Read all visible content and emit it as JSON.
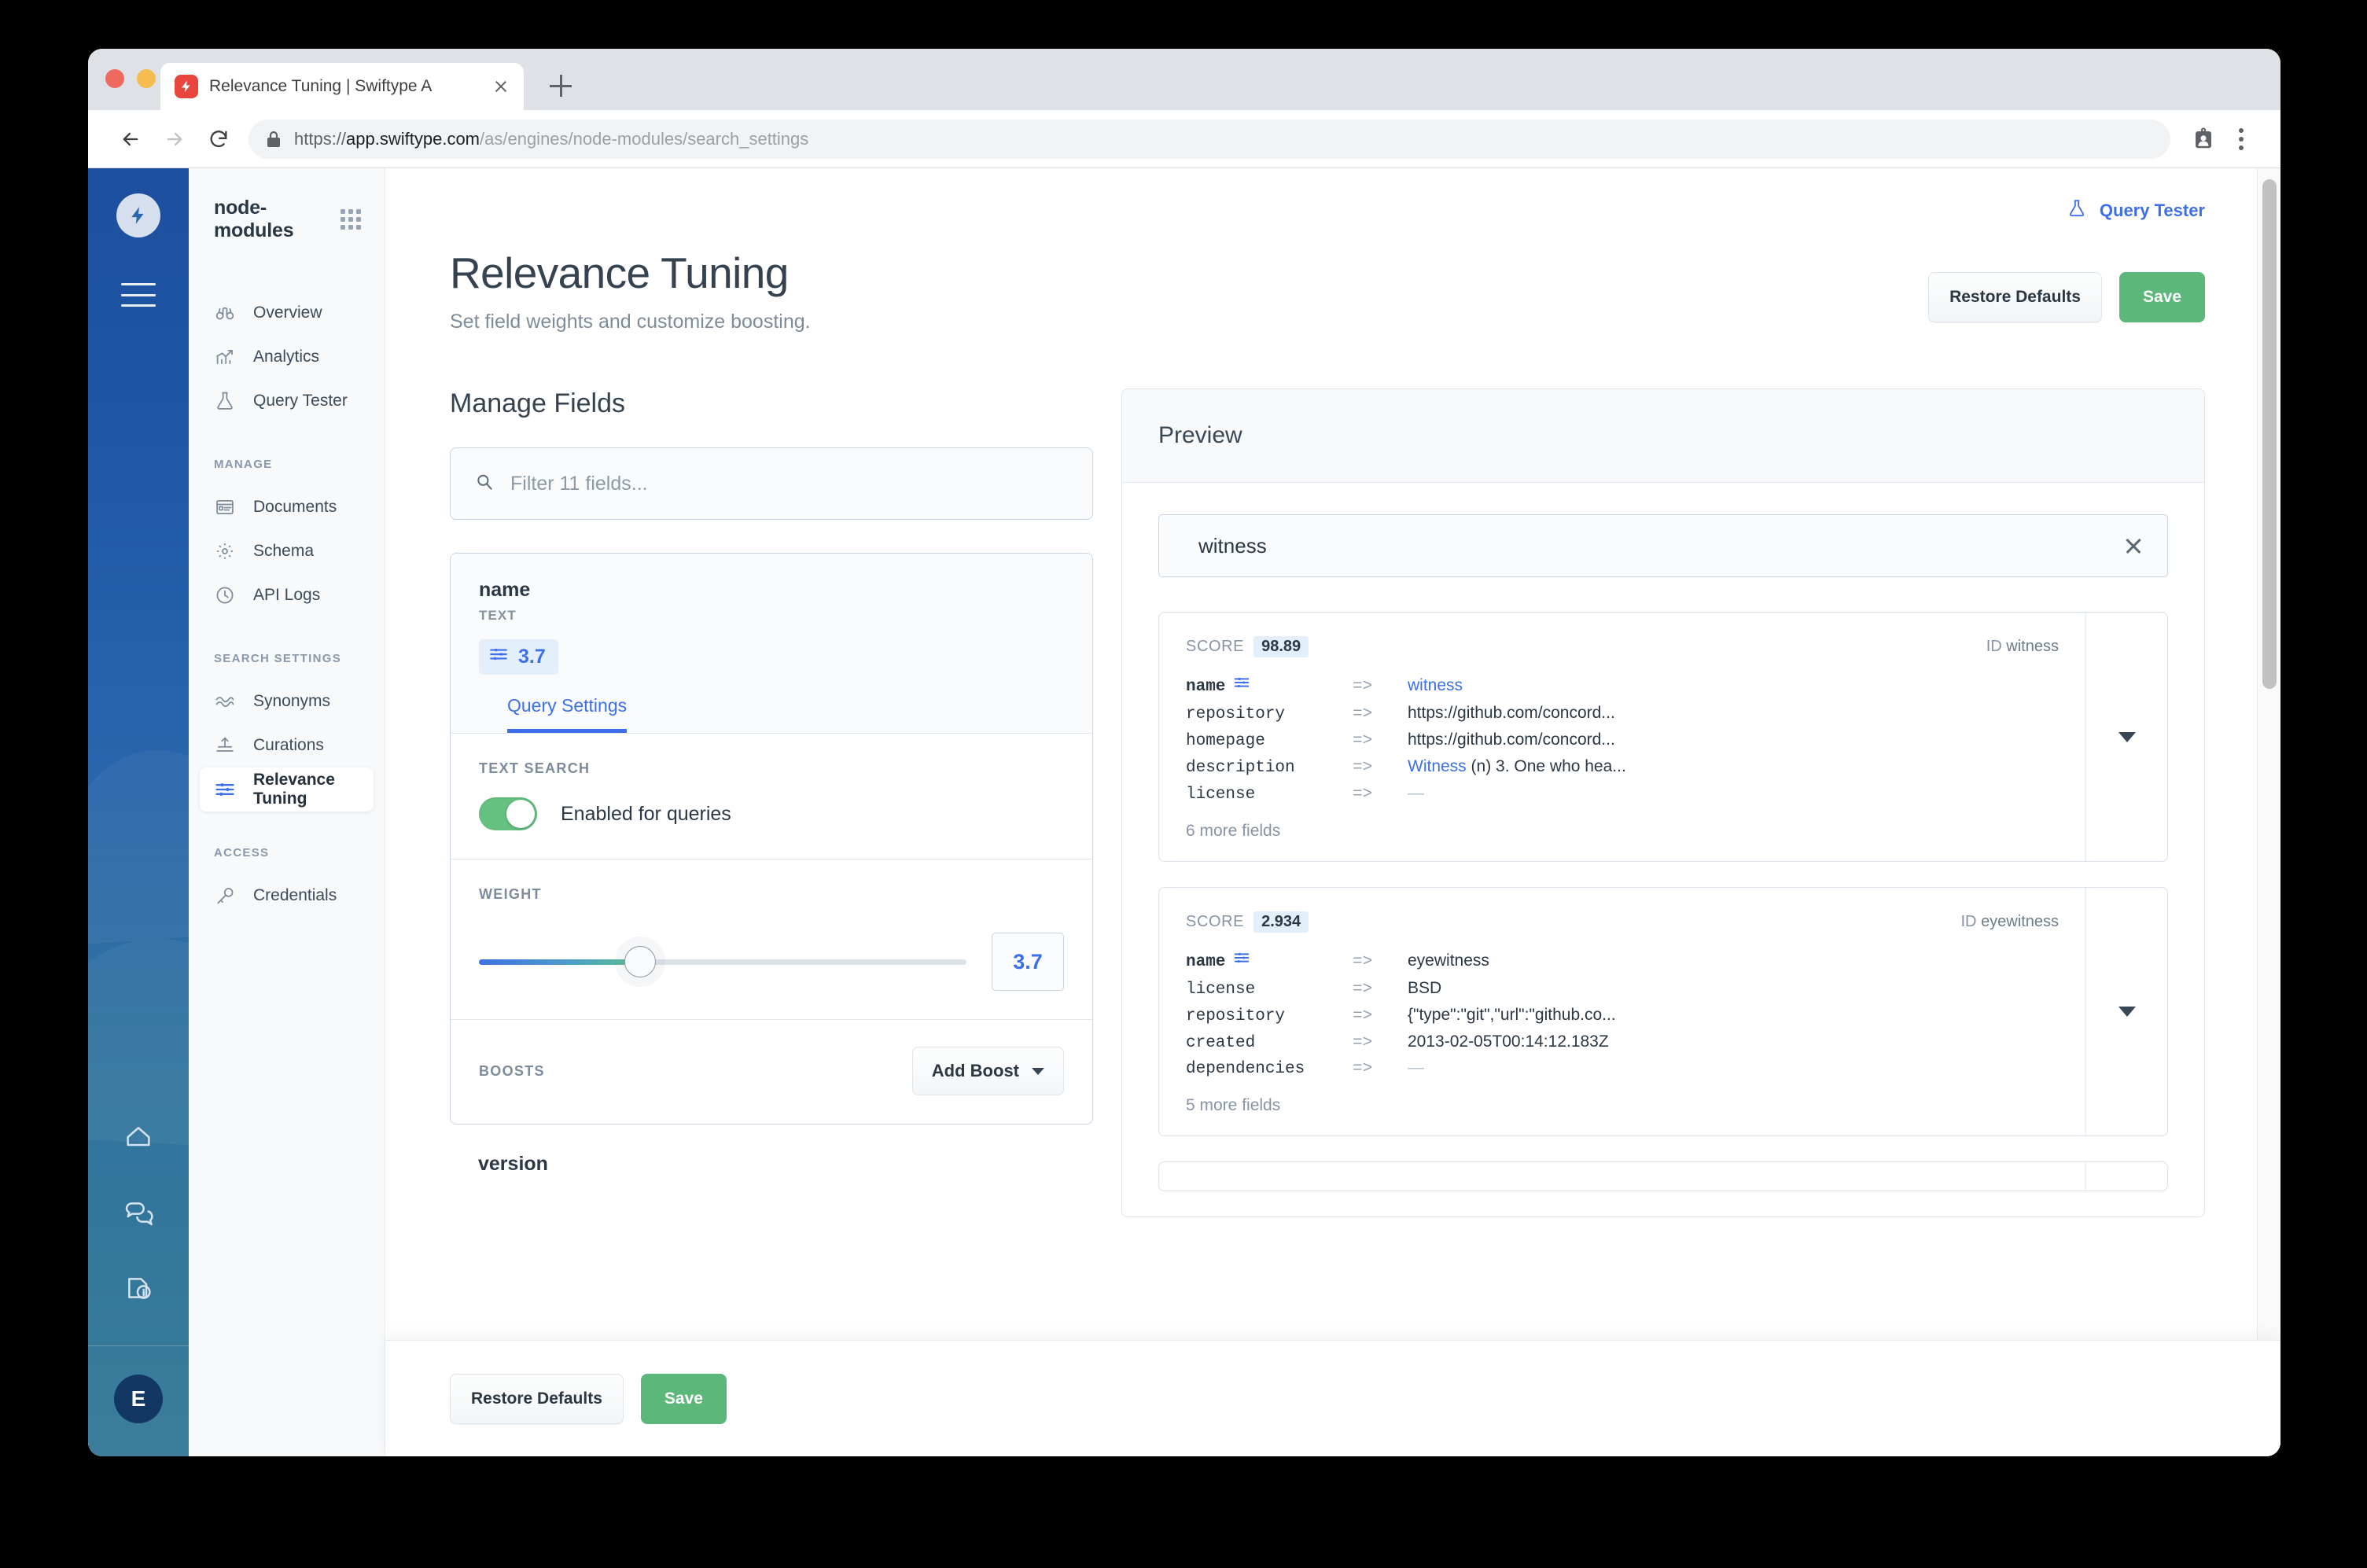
{
  "browser": {
    "tab_title": "Relevance Tuning | Swiftype A",
    "url_scheme": "https://",
    "url_domain": "app.swiftype.com",
    "url_path": "/as/engines/node-modules/search_settings",
    "new_tab_label": "+",
    "icons": {
      "back": "back-arrow-icon",
      "forward": "forward-arrow-icon",
      "reload": "reload-icon",
      "lock": "lock-icon",
      "profile": "profile-card-icon",
      "menu": "kebab-menu-icon"
    }
  },
  "rail": {
    "logo": "swiftype-bolt-logo",
    "menu": "hamburger-icon",
    "items": [
      {
        "name": "home-icon"
      },
      {
        "name": "chat-icon"
      },
      {
        "name": "docs-info-icon"
      }
    ],
    "avatar_initial": "E"
  },
  "sidebar": {
    "engine_name": "node-modules",
    "app_grid": "app-grid-icon",
    "items": [
      {
        "label": "Overview",
        "icon": "binoculars-icon",
        "active": false
      },
      {
        "label": "Analytics",
        "icon": "chart-trend-icon",
        "active": false
      },
      {
        "label": "Query Tester",
        "icon": "flask-icon",
        "active": false
      }
    ],
    "groups": [
      {
        "label": "MANAGE",
        "items": [
          {
            "label": "Documents",
            "icon": "document-list-icon",
            "active": false
          },
          {
            "label": "Schema",
            "icon": "gear-icon",
            "active": false
          },
          {
            "label": "API Logs",
            "icon": "clock-icon",
            "active": false
          }
        ]
      },
      {
        "label": "SEARCH SETTINGS",
        "items": [
          {
            "label": "Synonyms",
            "icon": "waves-icon",
            "active": false
          },
          {
            "label": "Curations",
            "icon": "curations-icon",
            "active": false
          },
          {
            "label": "Relevance Tuning",
            "icon": "sliders-icon",
            "active": true
          }
        ]
      },
      {
        "label": "ACCESS",
        "items": [
          {
            "label": "Credentials",
            "icon": "key-icon",
            "active": false
          }
        ]
      }
    ]
  },
  "header": {
    "query_tester_label": "Query Tester",
    "query_tester_icon": "flask-icon",
    "title": "Relevance Tuning",
    "subtitle": "Set field weights and customize boosting.",
    "restore_defaults_label": "Restore Defaults",
    "save_label": "Save"
  },
  "manage_fields": {
    "section_title": "Manage Fields",
    "filter_placeholder": "Filter 11 fields...",
    "filter_value": "",
    "filter_icon": "search-icon",
    "field_card": {
      "name": "name",
      "type": "TEXT",
      "weight_chip_icon": "sliders-icon",
      "weight_chip_value": "3.7",
      "tab_label": "Query Settings",
      "text_search_label": "TEXT SEARCH",
      "toggle_state": "on",
      "toggle_label": "Enabled for queries",
      "weight_label": "WEIGHT",
      "weight_value": "3.7",
      "weight_percent": 33,
      "boosts_label": "BOOSTS",
      "add_boost_label": "Add Boost"
    },
    "next_field_name": "version"
  },
  "preview": {
    "title": "Preview",
    "search_icon": "search-icon",
    "search_value": "witness",
    "clear_icon": "close-icon",
    "results": [
      {
        "score_label": "SCORE",
        "score": "98.89",
        "id_label": "ID",
        "id": "witness",
        "expand_icon": "chevron-down-icon",
        "fields": [
          {
            "key": "name",
            "bold": true,
            "icon": "sliders-icon",
            "value": "witness",
            "style": "blue"
          },
          {
            "key": "repository",
            "bold": false,
            "value": "https://github.com/concord...",
            "style": "plain"
          },
          {
            "key": "homepage",
            "bold": false,
            "value": "https://github.com/concord...",
            "style": "plain"
          },
          {
            "key": "description",
            "bold": false,
            "value_highlight": "Witness",
            "value_rest": " (n) 3. One who hea...",
            "style": "mixed"
          },
          {
            "key": "license",
            "bold": false,
            "value": "—",
            "style": "dash"
          }
        ],
        "more_fields": "6 more fields"
      },
      {
        "score_label": "SCORE",
        "score": "2.934",
        "id_label": "ID",
        "id": "eyewitness",
        "expand_icon": "chevron-down-icon",
        "fields": [
          {
            "key": "name",
            "bold": true,
            "icon": "sliders-icon",
            "value": "eyewitness",
            "style": "plain"
          },
          {
            "key": "license",
            "bold": false,
            "value": "BSD",
            "style": "plain"
          },
          {
            "key": "repository",
            "bold": false,
            "value": "{\"type\":\"git\",\"url\":\"github.co...",
            "style": "plain"
          },
          {
            "key": "created",
            "bold": false,
            "value": "2013-02-05T00:14:12.183Z",
            "style": "plain"
          },
          {
            "key": "dependencies",
            "bold": false,
            "value": "—",
            "style": "dash"
          }
        ],
        "more_fields": "5 more fields"
      }
    ]
  },
  "bottom_bar": {
    "restore_defaults_label": "Restore Defaults",
    "save_label": "Save"
  },
  "colors": {
    "accent_blue": "#3d6fe8",
    "save_green": "#5cb87a",
    "toggle_green": "#64c17f",
    "rail_blue": "#1f56a6",
    "text_dark": "#2b3744",
    "text_muted": "#8894a3"
  }
}
